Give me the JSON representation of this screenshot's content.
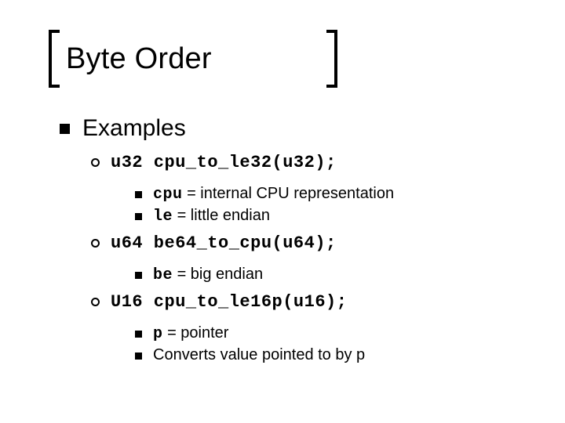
{
  "title": "Byte Order",
  "heading": "Examples",
  "items": [
    {
      "code": "u32 cpu_to_le32(u32);",
      "notes": [
        {
          "pre": "cpu",
          "post": " = internal CPU representation"
        },
        {
          "pre": "le",
          "post": " = little endian"
        }
      ]
    },
    {
      "code": "u64 be64_to_cpu(u64);",
      "notes": [
        {
          "pre": "be",
          "post": " = big endian"
        }
      ]
    },
    {
      "code": "U16 cpu_to_le16p(u16);",
      "notes": [
        {
          "pre": "p",
          "post": " = pointer"
        },
        {
          "pre": "",
          "post": "Converts value pointed to by p"
        }
      ]
    }
  ]
}
